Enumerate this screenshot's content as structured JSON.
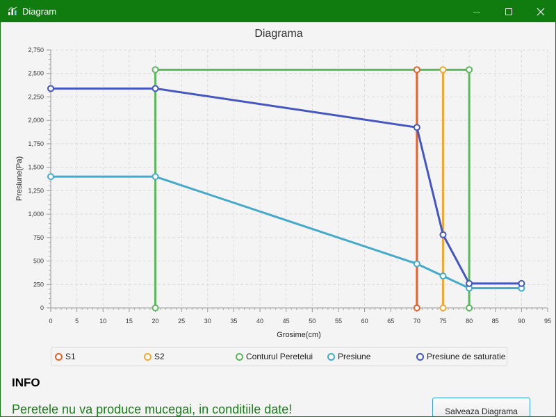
{
  "window": {
    "title": "Diagram",
    "icon": "chart-icon",
    "controls": [
      "minimize-icon",
      "maximize-icon",
      "close-icon"
    ],
    "titlebar_color": "#107c10"
  },
  "chart_data": {
    "type": "line",
    "title": "Diagrama",
    "xlabel": "Grosime(cm)",
    "ylabel": "Presiune(Pa)",
    "xlim": [
      0,
      95
    ],
    "ylim": [
      0,
      2750
    ],
    "x_ticks": [
      "0",
      "5",
      "10",
      "15",
      "20",
      "25",
      "30",
      "35",
      "40",
      "45",
      "50",
      "55",
      "60",
      "65",
      "70",
      "75",
      "80",
      "85",
      "90",
      "95"
    ],
    "y_ticks": [
      "0",
      "250",
      "500",
      "750",
      "1,000",
      "1,250",
      "1,500",
      "1,750",
      "2,000",
      "2,250",
      "2,500",
      "2,750"
    ],
    "grid": true,
    "legend_position": "bottom",
    "series": [
      {
        "name": "S1",
        "color": "#e8602c",
        "points": [
          [
            70,
            0
          ],
          [
            70,
            2540
          ]
        ]
      },
      {
        "name": "S2",
        "color": "#f0a830",
        "points": [
          [
            75,
            0
          ],
          [
            75,
            2540
          ]
        ]
      },
      {
        "name": "Conturul Peretelui",
        "color": "#5cb85c",
        "points": [
          [
            20,
            0
          ],
          [
            20,
            2540
          ],
          [
            80,
            2540
          ],
          [
            80,
            0
          ]
        ]
      },
      {
        "name": "Presiune",
        "color": "#44aacc",
        "points": [
          [
            0,
            1400
          ],
          [
            20,
            1400
          ],
          [
            70,
            470
          ],
          [
            75,
            340
          ],
          [
            80,
            210
          ],
          [
            90,
            210
          ]
        ]
      },
      {
        "name": "Presiune de saturatie",
        "color": "#4455c4",
        "points": [
          [
            0,
            2340
          ],
          [
            20,
            2340
          ],
          [
            70,
            1925
          ],
          [
            75,
            780
          ],
          [
            80,
            260
          ],
          [
            90,
            260
          ]
        ]
      }
    ]
  },
  "info": {
    "heading": "INFO",
    "message": "Peretele nu va produce mucegai, in conditiile date!",
    "message_color": "#1a7f1a"
  },
  "actions": {
    "save_label": "Salveaza Diagrama"
  }
}
